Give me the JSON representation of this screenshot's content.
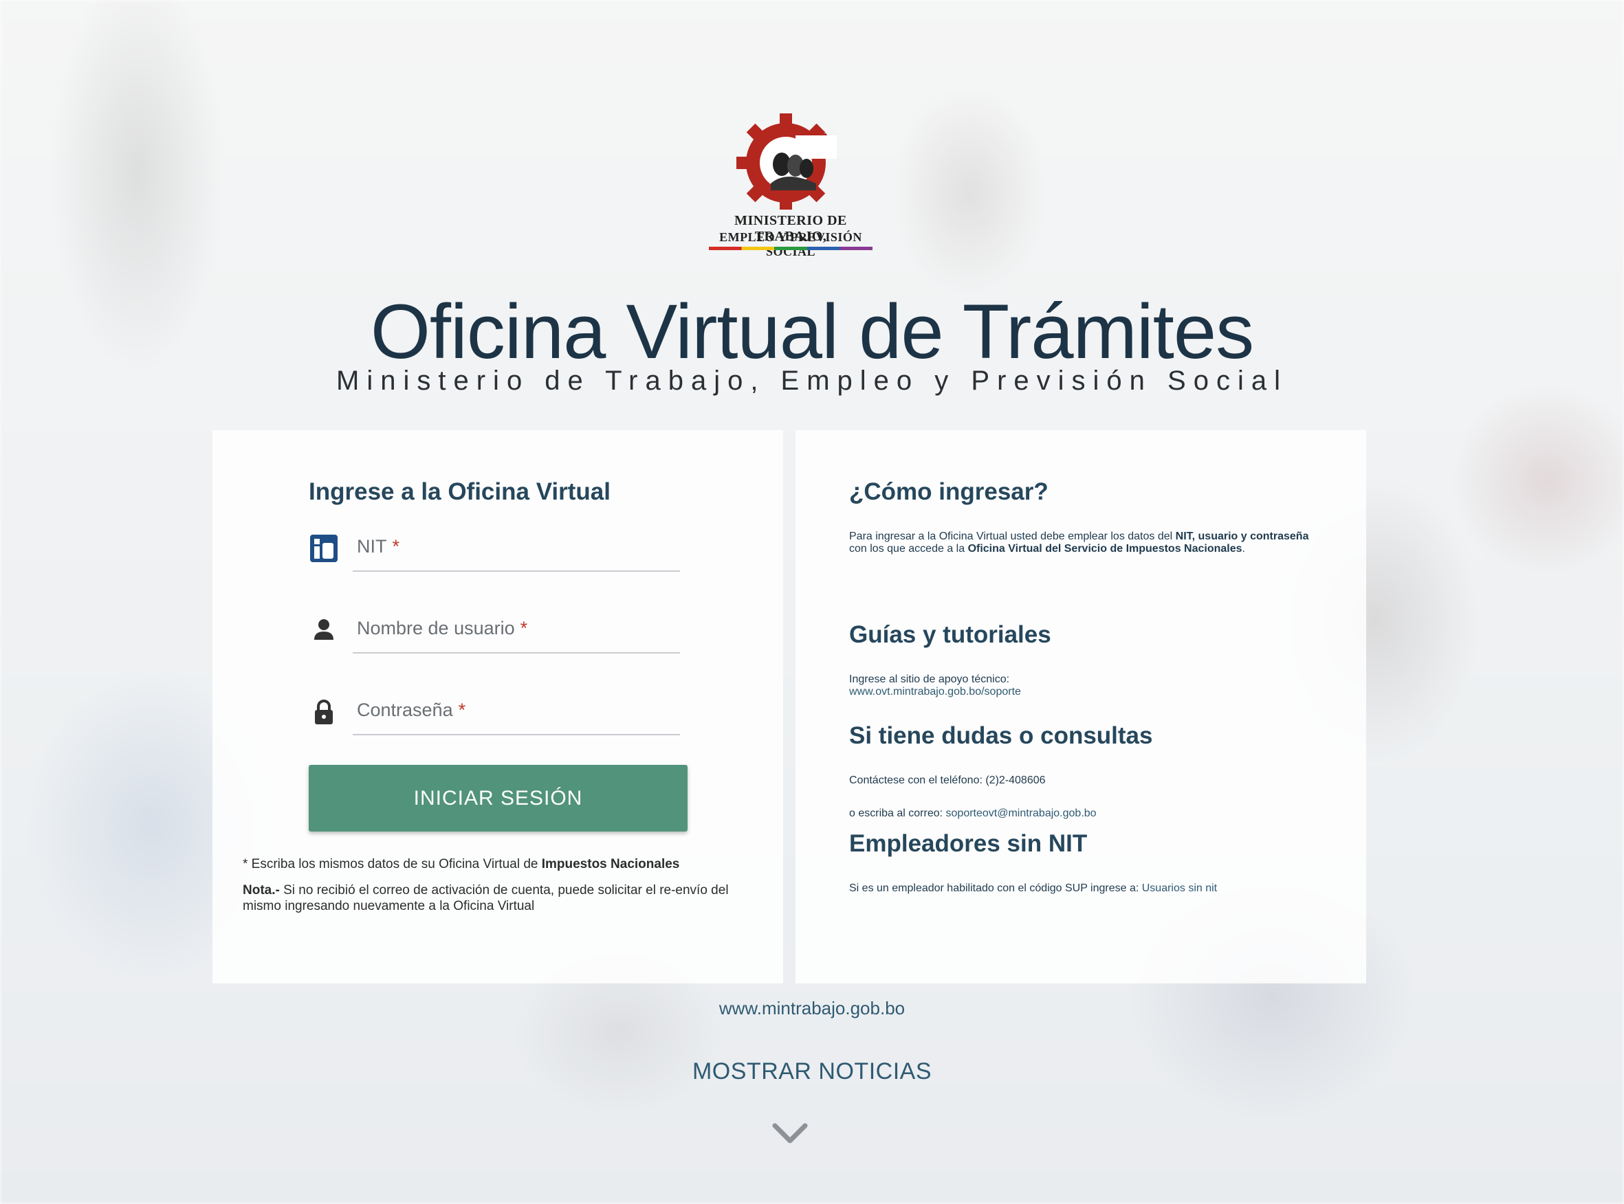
{
  "logo": {
    "line1": "MINISTERIO DE TRABAJO,",
    "line2": "EMPLEO Y PREVISIÓN SOCIAL",
    "icon": "gear-emblem-icon"
  },
  "header": {
    "title": "Oficina Virtual de Trámites",
    "subtitle": "Ministerio de Trabajo, Empleo y Previsión Social"
  },
  "login": {
    "title": "Ingrese a la Oficina Virtual",
    "fields": [
      {
        "label": "NIT",
        "required": "*",
        "icon": "id-card-icon",
        "value": ""
      },
      {
        "label": "Nombre de usuario",
        "required": "*",
        "icon": "user-icon",
        "value": ""
      },
      {
        "label": "Contraseña",
        "required": "*",
        "icon": "lock-icon",
        "value": ""
      }
    ],
    "button": "INICIAR SESIÓN",
    "note1_prefix": "* Escriba los mismos datos de su Oficina Virtual de ",
    "note1_bold": "Impuestos Nacionales",
    "note2_bold": "Nota.-",
    "note2_text": " Si no recibió el correo de activación de cuenta, puede solicitar el re-envío del mismo ingresando nuevamente a la Oficina Virtual"
  },
  "info": {
    "como_title": "¿Cómo ingresar?",
    "como_text_1": "Para ingresar a la Oficina Virtual usted debe emplear los datos del ",
    "como_bold_1": "NIT, usuario y contraseña",
    "como_text_2": " con los que accede a la ",
    "como_bold_2": "Oficina Virtual del Servicio de Impuestos Nacionales",
    "como_text_3": ".",
    "guias_title": "Guías y tutoriales",
    "guias_text": "Ingrese al sitio de apoyo técnico:",
    "guias_link": "www.ovt.mintrabajo.gob.bo/soporte",
    "dudas_title": "Si tiene dudas o consultas",
    "dudas_phone": "Contáctese con el teléfono: (2)2-408606",
    "dudas_mail_text": "o escriba al correo: ",
    "dudas_mail_link": "soporteovt@mintrabajo.gob.bo",
    "emp_title": "Empleadores sin NIT",
    "emp_text": "Si es un empleador habilitado con el código SUP ingrese a: ",
    "emp_link": "Usuarios sin nit"
  },
  "footer": {
    "site": "www.mintrabajo.gob.bo",
    "noticias": "MOSTRAR NOTICIAS",
    "chevron": "chevron-down-icon"
  },
  "colors": {
    "primary_button": "#51937b",
    "heading": "#26475c",
    "link": "#2f5a72",
    "required": "#c0392b"
  }
}
